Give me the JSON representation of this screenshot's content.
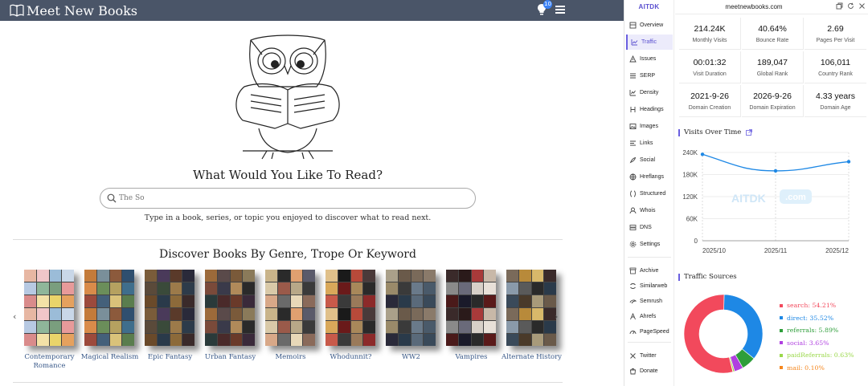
{
  "site": {
    "brand": "Meet New Books",
    "notification_count": "10",
    "headline": "What Would You Like To Read?",
    "search_value": "The So",
    "subtext": "Type in a book, series, or topic you enjoyed to discover what to read next.",
    "section_title": "Discover Books By Genre, Trope Or Keyword",
    "genres": [
      {
        "label": "Contemporary Romance",
        "colors": [
          "#e7b7a3",
          "#8fb69a",
          "#e9d46a",
          "#c9d7e8",
          "#d98b8b",
          "#f0c6c9",
          "#7a9e7e",
          "#e5a15e",
          "#b7c9e2",
          "#f3e1a7",
          "#9bbcd8",
          "#e79a9a"
        ]
      },
      {
        "label": "Magical Realism",
        "colors": [
          "#3f6e8c",
          "#c47b3a",
          "#6b8e5a",
          "#d9c27a",
          "#2f4f6f",
          "#9c4a3c",
          "#7a8f9a",
          "#b5a160",
          "#5a7d4e",
          "#d98b4a",
          "#44607a",
          "#8c5a3c"
        ]
      },
      {
        "label": "Epic Fantasy",
        "colors": [
          "#5a3a2a",
          "#2d3b4a",
          "#7a5c3a",
          "#3a4a3a",
          "#8c6a3a",
          "#2a2a3a",
          "#6a4a2a",
          "#4a3a5a",
          "#9c7a4a",
          "#3a2a2a",
          "#5a4a3a",
          "#2a3a4a"
        ]
      },
      {
        "label": "Urban Fantasy",
        "colors": [
          "#4a2a2a",
          "#7a5a3a",
          "#2a2a2a",
          "#9c6a3a",
          "#3a3a4a",
          "#6a3a2a",
          "#8a7a5a",
          "#2a3a3a",
          "#5a4a4a",
          "#b08a5a",
          "#3a2a3a",
          "#7a4a3a"
        ]
      },
      {
        "label": "Memoirs",
        "colors": [
          "#d9c9a8",
          "#6a6a6a",
          "#e0a070",
          "#3a3a3a",
          "#c9b48a",
          "#9a5a4a",
          "#e8d8b8",
          "#5a5a6a",
          "#d8a888",
          "#2a2a2a",
          "#b8a888",
          "#8a6a5a"
        ]
      },
      {
        "label": "Whodunnit?",
        "colors": [
          "#8c2a2a",
          "#d9a85a",
          "#3a3a3a",
          "#b84a3a",
          "#2a2a2a",
          "#e0c08a",
          "#6a1a1a",
          "#9a7a5a",
          "#4a3a3a",
          "#c85a4a",
          "#1a1a1a",
          "#a8885a"
        ]
      },
      {
        "label": "WW2",
        "colors": [
          "#6a7a8a",
          "#3a4a5a",
          "#9a8a6a",
          "#2a3a4a",
          "#7a6a5a",
          "#4a5a6a",
          "#aaa08a",
          "#3a3a3a",
          "#5a6a7a",
          "#8a7a6a",
          "#2a2a3a",
          "#6a5a4a"
        ]
      },
      {
        "label": "Vampires",
        "colors": [
          "#2a1a1a",
          "#d8d0c8",
          "#5a1a1a",
          "#8a8a8a",
          "#1a1a2a",
          "#a83a3a",
          "#e8e0d8",
          "#3a2a2a",
          "#6a6a7a",
          "#2a2a2a",
          "#c8b8a8",
          "#4a1a1a"
        ]
      },
      {
        "label": "Alternate History",
        "colors": [
          "#3a4a5a",
          "#b88a3a",
          "#2a2a2a",
          "#6a5a4a",
          "#8a9aaa",
          "#4a3a2a",
          "#d8b86a",
          "#2a3a4a",
          "#7a6a5a",
          "#5a5a5a",
          "#a89a7a",
          "#3a2a2a"
        ]
      }
    ]
  },
  "aitdk": {
    "logo": "AITDK",
    "domain": "meetnewbooks.com",
    "nav_top": [
      {
        "label": "Overview",
        "icon": "overview-icon"
      },
      {
        "label": "Traffic",
        "icon": "traffic-icon",
        "active": true
      },
      {
        "label": "Issues",
        "icon": "issues-icon"
      },
      {
        "label": "SERP",
        "icon": "serp-icon"
      },
      {
        "label": "Density",
        "icon": "density-icon"
      },
      {
        "label": "Headings",
        "icon": "headings-icon"
      },
      {
        "label": "Images",
        "icon": "images-icon"
      },
      {
        "label": "Links",
        "icon": "links-icon"
      },
      {
        "label": "Social",
        "icon": "social-icon"
      },
      {
        "label": "Hreflangs",
        "icon": "hreflangs-icon"
      },
      {
        "label": "Structured",
        "icon": "structured-icon"
      },
      {
        "label": "Whois",
        "icon": "whois-icon"
      },
      {
        "label": "DNS",
        "icon": "dns-icon"
      },
      {
        "label": "Settings",
        "icon": "settings-icon"
      }
    ],
    "nav_tools": [
      {
        "label": "Archive",
        "icon": "archive-icon"
      },
      {
        "label": "Similarweb",
        "icon": "similarweb-icon"
      },
      {
        "label": "Semrush",
        "icon": "semrush-icon"
      },
      {
        "label": "Ahrefs",
        "icon": "ahrefs-icon"
      },
      {
        "label": "PageSpeed",
        "icon": "pagespeed-icon"
      }
    ],
    "nav_bottom": [
      {
        "label": "Twitter",
        "icon": "twitter-icon"
      },
      {
        "label": "Donate",
        "icon": "donate-icon"
      }
    ],
    "stats": [
      {
        "value": "214.24K",
        "label": "Monthly Visits"
      },
      {
        "value": "40.64%",
        "label": "Bounce Rate"
      },
      {
        "value": "2.69",
        "label": "Pages Per Visit"
      },
      {
        "value": "00:01:32",
        "label": "Visit Duration"
      },
      {
        "value": "189,047",
        "label": "Global Rank"
      },
      {
        "value": "106,011",
        "label": "Country Rank"
      },
      {
        "value": "2021-9-26",
        "label": "Domain Creation"
      },
      {
        "value": "2026-9-26",
        "label": "Domain Expiration"
      },
      {
        "value": "4.33 years",
        "label": "Domain Age"
      }
    ],
    "visits_title": "Visits Over Time",
    "traffic_title": "Traffic Sources",
    "watermark": "AITDK",
    "watermark_suffix": ".com"
  },
  "chart_data": [
    {
      "type": "line",
      "title": "Visits Over Time",
      "x": [
        "2025/10",
        "2025/11",
        "2025/12"
      ],
      "y_ticks": [
        "0",
        "60K",
        "120K",
        "180K",
        "240K"
      ],
      "ylim": [
        0,
        240000
      ],
      "series": [
        {
          "values": [
            235000,
            190000,
            215000
          ]
        }
      ],
      "color": "#1e88e5",
      "grid": true
    },
    {
      "type": "pie",
      "title": "Traffic Sources",
      "legend_position": "right",
      "slices": [
        {
          "name": "search",
          "label": "search: 54.21%",
          "value": 54.21,
          "color": "#f2495c"
        },
        {
          "name": "direct",
          "label": "direct: 35.52%",
          "value": 35.52,
          "color": "#1e88e5"
        },
        {
          "name": "referrals",
          "label": "referrals: 5.89%",
          "value": 5.89,
          "color": "#2e9e3a"
        },
        {
          "name": "social",
          "label": "social: 3.65%",
          "value": 3.65,
          "color": "#b040e0"
        },
        {
          "name": "paidReferrals",
          "label": "paidReferrals: 0.63%",
          "value": 0.63,
          "color": "#9ad84a"
        },
        {
          "name": "mail",
          "label": "mail: 0.10%",
          "value": 0.1,
          "color": "#f5871f"
        }
      ]
    }
  ]
}
